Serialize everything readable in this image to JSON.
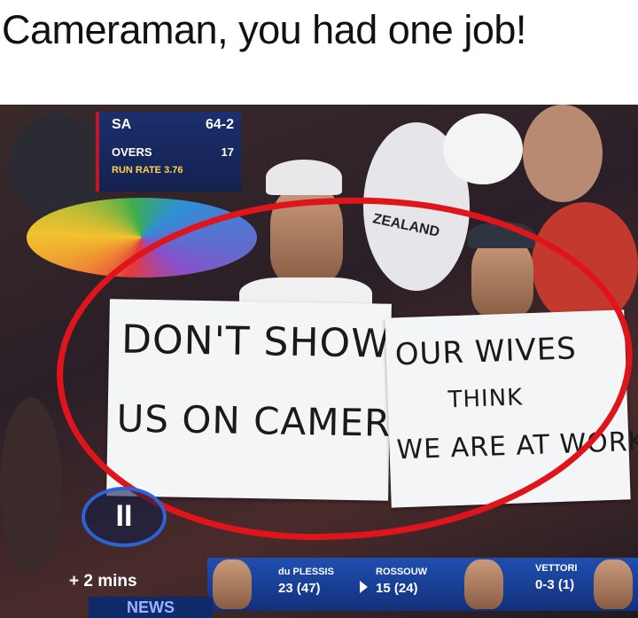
{
  "caption": "Cameraman, you had one job!",
  "scoreboard": {
    "team": "SA",
    "runs": "64-2",
    "overs_label": "OVERS",
    "overs_value": "17",
    "run_rate": "RUN RATE 3.76"
  },
  "sign_left": {
    "line1": "DON'T SHOW",
    "line2": "US ON CAMERA"
  },
  "sign_right": {
    "line1": "OUR WIVES",
    "line2": "THINK",
    "line3": "WE ARE AT WORK"
  },
  "shirt_text": "ZEALAND",
  "broadcast": {
    "clock": "+ 2 mins",
    "pause_symbol": "II",
    "channel": "NEWS",
    "batsman1_name": "du PLESSIS",
    "batsman1_score": "23 (47)",
    "batsman2_name": "ROSSOUW",
    "batsman2_score": "15 (24)",
    "bowler_name": "VETTORI",
    "bowler_figures": "0-3 (1)"
  },
  "colors": {
    "ring": "#e0141b",
    "scoreboard": "#1c2f6e",
    "strip": "#1f4fb0"
  }
}
